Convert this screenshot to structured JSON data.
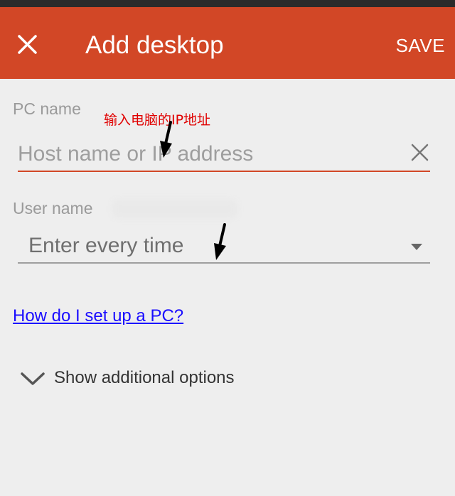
{
  "app_bar": {
    "title": "Add desktop",
    "save_label": "SAVE",
    "close_icon": "close-icon",
    "background": "#d24726"
  },
  "form": {
    "pc_name": {
      "label": "PC name",
      "placeholder": "Host name or IP address",
      "value": "",
      "clear_icon": "close-icon",
      "underline_color": "#d24726"
    },
    "user_name": {
      "label": "User name",
      "selected": "Enter every time",
      "dropdown_icon": "caret-down-icon"
    },
    "help_link": "How do I set up a PC?",
    "additional_options": {
      "label": "Show additional options",
      "icon": "chevron-down-icon"
    }
  },
  "annotation": {
    "text": "输入电脑的IP地址",
    "color": "#e00000"
  }
}
